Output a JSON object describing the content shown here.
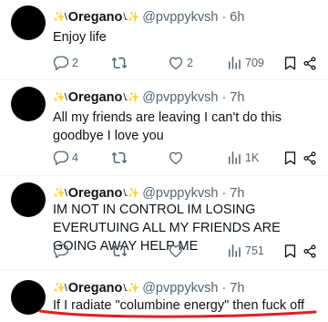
{
  "tweets": [
    {
      "name": "Oregano",
      "deco_left": "✨\\",
      "deco_right": "\\.✨",
      "handle": "@pvppykvsh",
      "time": "· 6h",
      "text": "Enjoy life",
      "replies": "2",
      "retweets": "",
      "likes": "2",
      "views": "709"
    },
    {
      "name": "Oregano",
      "deco_left": "✨\\",
      "deco_right": "\\.✨",
      "handle": "@pvppykvsh",
      "time": "· 7h",
      "text": "All my friends are leaving I can't do this goodbye I love you",
      "replies": "4",
      "retweets": "",
      "likes": "",
      "views": "1K"
    },
    {
      "name": "Oregano",
      "deco_left": "✨\\",
      "deco_right": "\\.✨",
      "handle": "@pvppykvsh",
      "time": "· 7h",
      "text": "IM NOT IN CONTROL IM LOSING EVERUTUING ALL MY FRIENDS ARE GOING AWAY HELP ME",
      "replies": "",
      "retweets": "",
      "likes": "",
      "views": "751"
    },
    {
      "name": "Oregano",
      "deco_left": "✨\\",
      "deco_right": "\\.✨",
      "handle": "@pvppykvsh",
      "time": "· 7h",
      "text": "If I radiate \"columbine energy\" then fuck off"
    }
  ],
  "colors": {
    "text": "#0f1419",
    "muted": "#536471",
    "divider": "#eff3f4",
    "annotation": "#e0201f"
  },
  "icons": [
    "reply-icon",
    "retweet-icon",
    "like-icon",
    "views-icon",
    "bookmark-icon",
    "share-icon"
  ]
}
